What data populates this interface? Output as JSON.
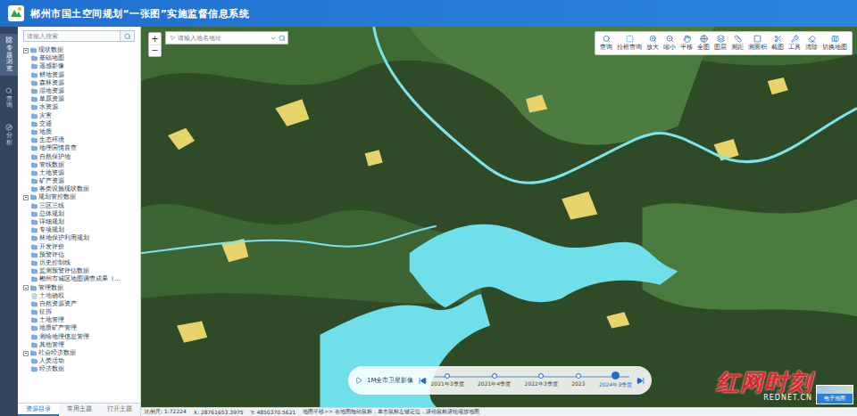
{
  "header": {
    "title": "郴州市国土空间规划“一张图”实施监督信息系统"
  },
  "nav": [
    {
      "label": "专题浏览",
      "selected": true
    },
    {
      "label": "查询",
      "selected": false
    },
    {
      "label": "分析",
      "selected": false
    }
  ],
  "sidebar": {
    "search": {
      "placeholder": "请输入搜索"
    },
    "groups": [
      {
        "label": "现状数据",
        "expanded": true,
        "items": [
          {
            "label": "基础地图",
            "kind": "folder"
          },
          {
            "label": "遥感影像",
            "kind": "folder"
          },
          {
            "label": "耕地资源",
            "kind": "folder"
          },
          {
            "label": "森林资源",
            "kind": "folder"
          },
          {
            "label": "湿地资源",
            "kind": "folder"
          },
          {
            "label": "草原资源",
            "kind": "folder"
          },
          {
            "label": "水资源",
            "kind": "folder"
          },
          {
            "label": "灾害",
            "kind": "folder"
          },
          {
            "label": "交通",
            "kind": "folder"
          },
          {
            "label": "地质",
            "kind": "folder"
          },
          {
            "label": "生态环境",
            "kind": "folder"
          },
          {
            "label": "地理国情普查",
            "kind": "folder"
          },
          {
            "label": "自然保护地",
            "kind": "folder"
          },
          {
            "label": "管线数据",
            "kind": "folder"
          },
          {
            "label": "土地资源",
            "kind": "folder"
          },
          {
            "label": "矿产资源",
            "kind": "folder"
          },
          {
            "label": "各类设施现状数据",
            "kind": "folder"
          }
        ]
      },
      {
        "label": "规划管控数据",
        "expanded": true,
        "items": [
          {
            "label": "三区三线",
            "kind": "folder"
          },
          {
            "label": "总体规划",
            "kind": "folder"
          },
          {
            "label": "详细规划",
            "kind": "folder"
          },
          {
            "label": "专项规划",
            "kind": "folder"
          },
          {
            "label": "林地保护利用规划",
            "kind": "folder"
          },
          {
            "label": "开发评价",
            "kind": "folder"
          },
          {
            "label": "预警评估",
            "kind": "folder"
          },
          {
            "label": "历史控制线",
            "kind": "folder"
          },
          {
            "label": "监测预警评估数据",
            "kind": "folder"
          },
          {
            "label": "郴州市城区地图调查成果（...",
            "kind": "folder"
          }
        ]
      },
      {
        "label": "管理数据",
        "expanded": true,
        "items": [
          {
            "label": "土地确权",
            "kind": "layer"
          },
          {
            "label": "自然资源资产",
            "kind": "folder"
          },
          {
            "label": "征拆",
            "kind": "folder"
          },
          {
            "label": "土地管理",
            "kind": "folder"
          },
          {
            "label": "地质矿产管理",
            "kind": "folder"
          },
          {
            "label": "测绘地理信息管理",
            "kind": "folder"
          },
          {
            "label": "其他管理",
            "kind": "folder"
          }
        ]
      },
      {
        "label": "社会经济数据",
        "expanded": true,
        "items": [
          {
            "label": "人类活动",
            "kind": "folder"
          },
          {
            "label": "经济数据",
            "kind": "folder"
          }
        ]
      }
    ],
    "tabs": [
      {
        "label": "资源目录",
        "selected": true
      },
      {
        "label": "常用主题",
        "selected": false
      },
      {
        "label": "打开主题",
        "selected": false
      }
    ]
  },
  "map": {
    "search": {
      "placeholder": "请输入地名地址"
    },
    "zoom": [
      "+",
      "−"
    ],
    "toolbar": [
      "查询",
      "拉框查询",
      "放大",
      "缩小",
      "平移",
      "全图",
      "图层",
      "测距",
      "测面积",
      "截图",
      "工具",
      "清除",
      "切换地图"
    ],
    "timeline": {
      "label": "1M全市卫星影像",
      "ticks": [
        {
          "label": "2021年3季度",
          "selected": false
        },
        {
          "label": "2021年4季度",
          "selected": false
        },
        {
          "label": "2022年3季度",
          "selected": false
        },
        {
          "label": "2023",
          "selected": false
        },
        {
          "label": "2024年3季度",
          "selected": true
        }
      ]
    },
    "basemap_button": "电子地图"
  },
  "status_bar": {
    "scale": "比例尺: 1:72224",
    "x": "X: 28761653.3975",
    "y": "Y: 4850370.5621",
    "hint": "地图平移>> 在地图拖动鼠标，单击鼠标左键定位，滚动鼠标滚轮缩放地图"
  },
  "watermark": {
    "brand": "红网时刻",
    "site": "REDNET.CN"
  }
}
